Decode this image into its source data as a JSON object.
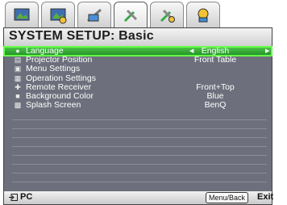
{
  "tabs": [
    {
      "name": "picture-tab",
      "icon": "picture-icon"
    },
    {
      "name": "picture-advanced-tab",
      "icon": "picture-advanced-icon"
    },
    {
      "name": "display-tab",
      "icon": "display-icon"
    },
    {
      "name": "system-setup-basic-tab",
      "icon": "tools-icon",
      "active": true
    },
    {
      "name": "system-setup-advanced-tab",
      "icon": "tools-advanced-icon"
    },
    {
      "name": "information-tab",
      "icon": "info-icon"
    }
  ],
  "header": {
    "title": "SYSTEM SETUP: Basic"
  },
  "menu": {
    "items": [
      {
        "label": "Language",
        "value": "English",
        "icon": "language-icon",
        "selected": true
      },
      {
        "label": "Projector Position",
        "value": "Front Table",
        "icon": "projector-icon"
      },
      {
        "label": "Menu Settings",
        "value": "",
        "icon": "menu-icon"
      },
      {
        "label": "Operation Settings",
        "value": "",
        "icon": "operation-icon"
      },
      {
        "label": "Remote Receiver",
        "value": "Front+Top",
        "icon": "remote-icon"
      },
      {
        "label": "Background Color",
        "value": "Blue",
        "icon": "color-icon"
      },
      {
        "label": "Splash Screen",
        "value": "BenQ",
        "icon": "splash-icon"
      }
    ]
  },
  "footer": {
    "source": "PC",
    "key_hint": "Menu/Back",
    "exit": "Exit"
  }
}
